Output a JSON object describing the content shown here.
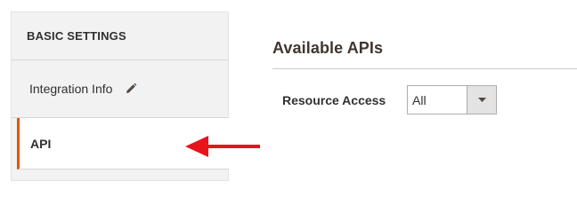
{
  "sidebar": {
    "header": "BASIC SETTINGS",
    "items": [
      {
        "label": "Integration Info",
        "icon": "pencil-icon"
      },
      {
        "label": "API",
        "active": true
      }
    ]
  },
  "main": {
    "section_title": "Available APIs",
    "resource_access": {
      "label": "Resource Access",
      "selected": "All"
    }
  },
  "colors": {
    "accent": "#eb5202",
    "annotation_arrow": "#e8141b",
    "sidebar_bg": "#f2f2f2"
  }
}
